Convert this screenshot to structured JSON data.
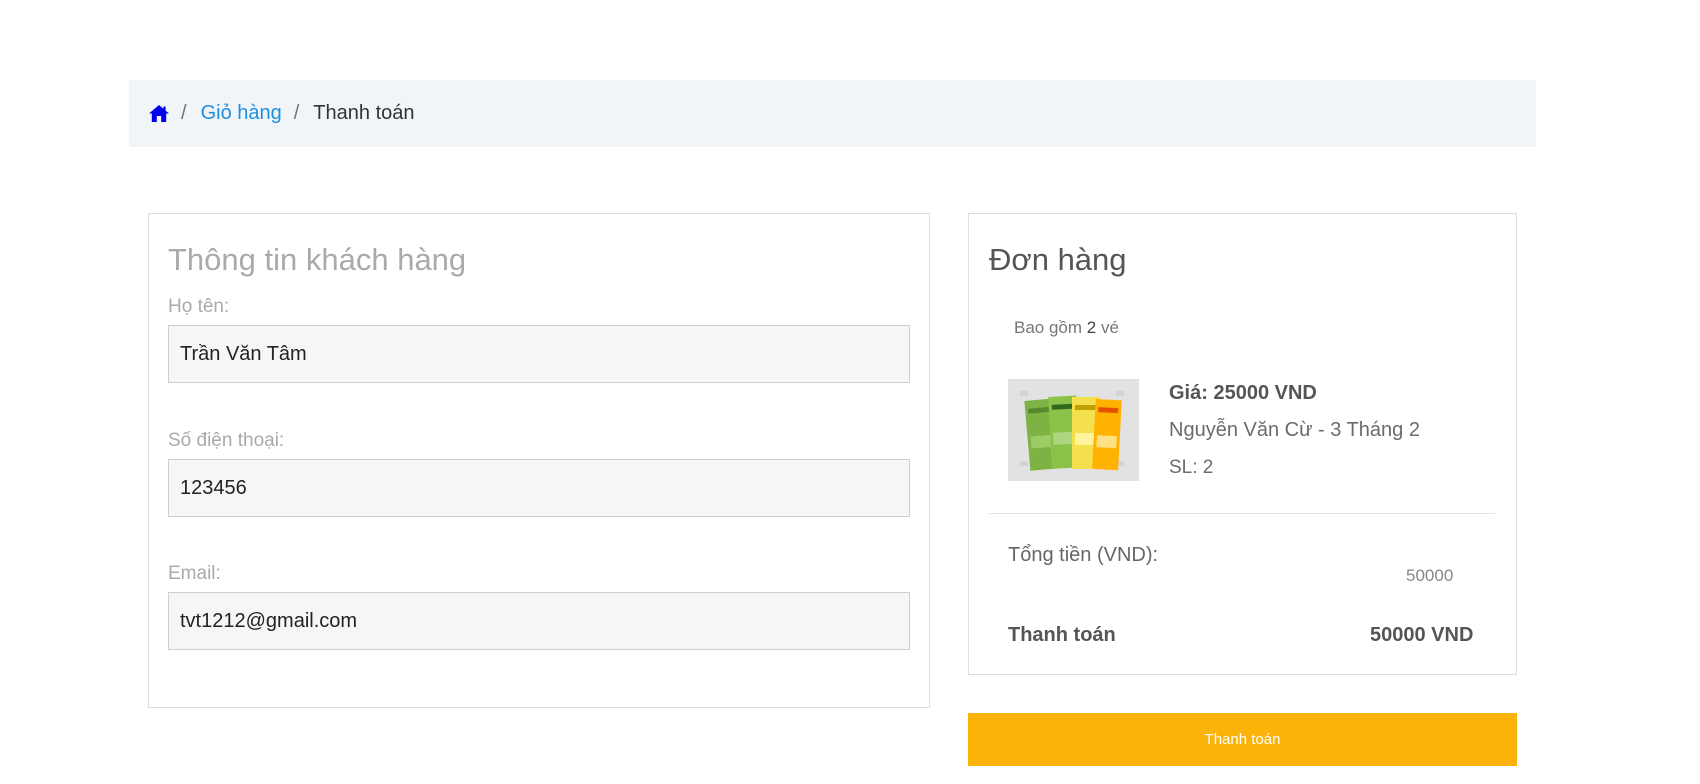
{
  "breadcrumb": {
    "home_icon": "home-icon",
    "separator": "/",
    "cart_label": "Giỏ hàng",
    "current_label": "Thanh toán"
  },
  "customer": {
    "title": "Thông tin khách hàng",
    "name_label": "Họ tên:",
    "name_value": "Trần Văn Tâm",
    "phone_label": "Số điện thoại:",
    "phone_value": "123456",
    "email_label": "Email:",
    "email_value": "tvt1212@gmail.com"
  },
  "order": {
    "title": "Đơn hàng",
    "count_prefix": "Bao gồm",
    "count_value": "2",
    "count_suffix": "vé",
    "item": {
      "price": "Giá: 25000 VND",
      "name": "Nguyễn Văn Cừ - 3 Tháng 2",
      "quantity": "SL: 2"
    },
    "total_label": "Tổng tiền (VND):",
    "total_value": "50000",
    "pay_label": "Thanh toán",
    "pay_value": "50000 VND"
  },
  "actions": {
    "pay_button": "Thanh toán"
  },
  "colors": {
    "accent": "#fbb30a",
    "link": "#1e90e0",
    "home_icon": "#0000ee",
    "breadcrumb_bg": "#f2f5f8"
  }
}
